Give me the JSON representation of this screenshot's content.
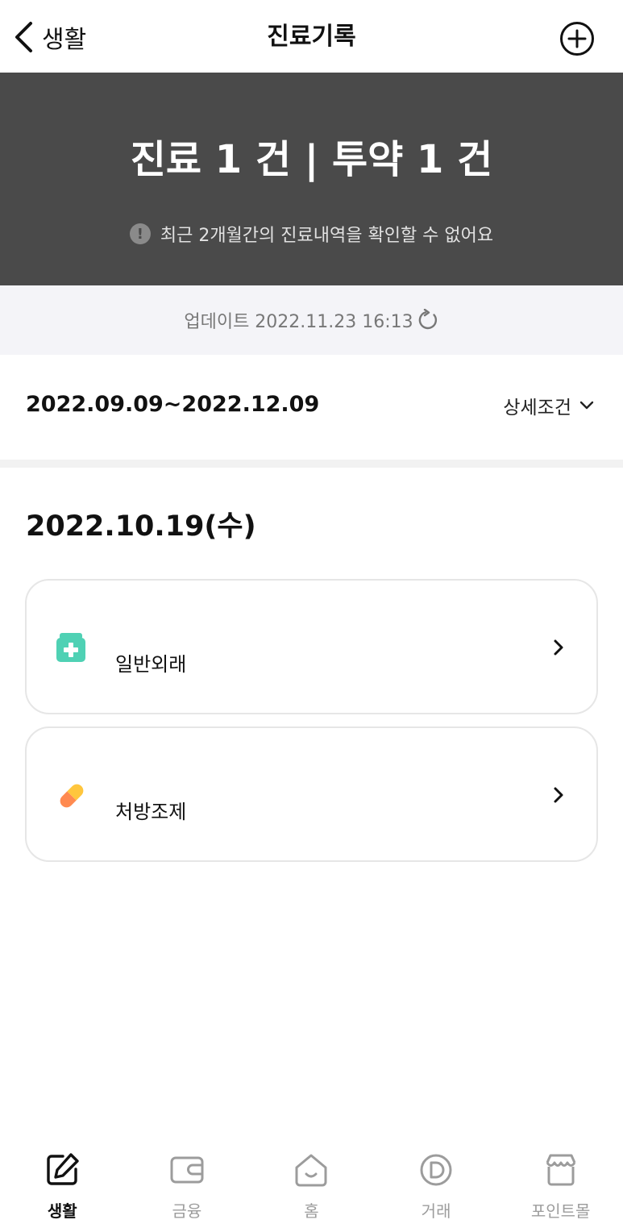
{
  "header": {
    "back_label": "생활",
    "title": "진료기록"
  },
  "summary": {
    "counts": "진료 1 건 | 투약 1 건",
    "notice": "최근 2개월간의 진료내역을 확인할 수 없어요",
    "notice_icon": "!"
  },
  "update": {
    "text": "업데이트 2022.11.23 16:13"
  },
  "filter": {
    "date_range": "2022.09.09~2022.12.09",
    "detail_label": "상세조건"
  },
  "records": {
    "date": "2022.10.19(수)",
    "items": [
      {
        "label": "일반외래",
        "icon": "medical-kit-icon"
      },
      {
        "label": "처방조제",
        "icon": "pill-icon"
      }
    ]
  },
  "nav": {
    "items": [
      {
        "label": "생활",
        "icon": "edit-icon",
        "active": true
      },
      {
        "label": "금융",
        "icon": "wallet-icon"
      },
      {
        "label": "홈",
        "icon": "home-icon"
      },
      {
        "label": "거래",
        "icon": "coin-icon"
      },
      {
        "label": "포인트몰",
        "icon": "store-icon"
      }
    ]
  },
  "colors": {
    "banner_bg": "#4a4a4a",
    "update_bg": "#f4f4f8",
    "medical_icon": "#4fd1b4",
    "pill_icon_orange": "#ff8a50",
    "pill_icon_yellow": "#ffc63d",
    "nav_active": "#111111",
    "nav_inactive": "#9c9c9c"
  }
}
